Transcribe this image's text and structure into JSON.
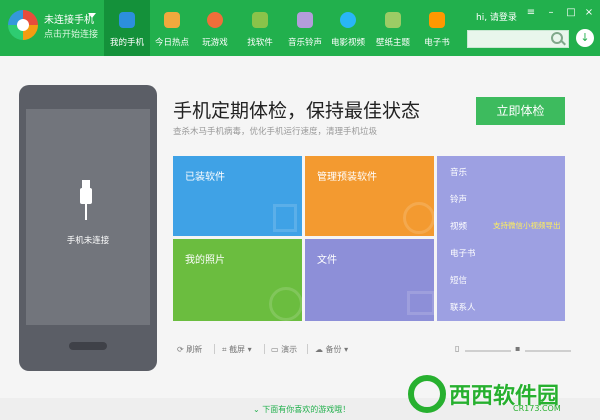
{
  "topbar": {
    "connection_title": "未连接手机",
    "connection_sub": "点击开始连接",
    "user": "hi, 请登录",
    "tabs": [
      {
        "label": "我的手机",
        "icon": "phone-icon",
        "color": "#2c8fdd"
      },
      {
        "label": "今日热点",
        "icon": "hot-icon",
        "color": "#f0a93d"
      },
      {
        "label": "玩游戏",
        "icon": "game-icon",
        "color": "#f06e3a"
      },
      {
        "label": "找软件",
        "icon": "android-icon",
        "color": "#8bc34a"
      },
      {
        "label": "音乐铃声",
        "icon": "music-icon",
        "color": "#b39ddb"
      },
      {
        "label": "电影视频",
        "icon": "video-icon",
        "color": "#29b6f6"
      },
      {
        "label": "壁纸主题",
        "icon": "wallpaper-icon",
        "color": "#9ccc65"
      },
      {
        "label": "电子书",
        "icon": "ebook-icon",
        "color": "#ff9800"
      }
    ]
  },
  "phone": {
    "label": "手机未连接"
  },
  "main": {
    "headline": "手机定期体检，保持最佳状态",
    "subline": "查杀木马手机病毒，优化手机运行速度，清理手机垃圾",
    "check_button": "立即体检"
  },
  "tiles": {
    "installed": "已装软件",
    "preinstalled": "管理预装软件",
    "photos": "我的照片",
    "files": "文件"
  },
  "panel": {
    "items": [
      "音乐",
      "铃声",
      "视频",
      "电子书",
      "短信",
      "联系人"
    ],
    "promo": "支持微信小视频导出"
  },
  "toolbar": {
    "refresh": "刷新",
    "screenshot": "截屏",
    "demo": "演示",
    "backup": "备份"
  },
  "bottom": {
    "game_link": "下面有你喜欢的游戏哦！"
  },
  "watermark": {
    "text": "西西软件园",
    "url": "CR173.COM"
  }
}
